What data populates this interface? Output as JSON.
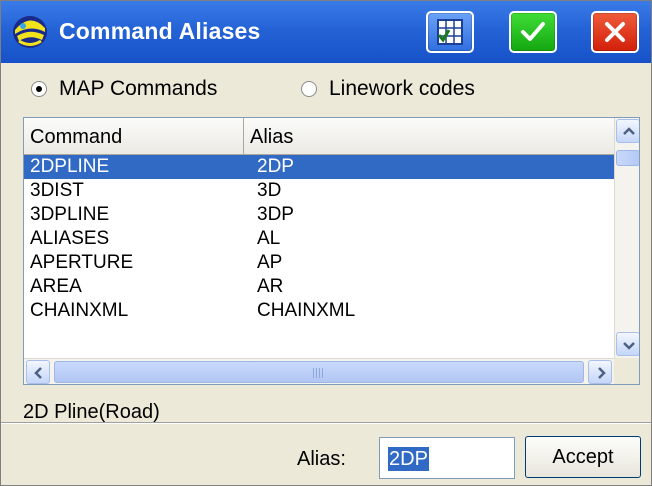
{
  "window": {
    "title": "Command Aliases",
    "icons": {
      "app": "helmet-icon",
      "grid": "grid-check-icon",
      "ok": "checkmark-icon",
      "close": "close-icon"
    },
    "colors": {
      "titlebar": "#2463d6",
      "ok": "#1fbf19",
      "close": "#e0341a",
      "selection": "#316ac5"
    }
  },
  "filter": {
    "options": [
      {
        "label": "MAP Commands",
        "checked": true
      },
      {
        "label": "Linework codes",
        "checked": false
      }
    ]
  },
  "list": {
    "columns": [
      "Command",
      "Alias"
    ],
    "rows": [
      {
        "command": "2DPLINE",
        "alias": "2DP",
        "selected": true
      },
      {
        "command": "3DIST",
        "alias": "3D",
        "selected": false
      },
      {
        "command": "3DPLINE",
        "alias": "3DP",
        "selected": false
      },
      {
        "command": "ALIASES",
        "alias": "AL",
        "selected": false
      },
      {
        "command": "APERTURE",
        "alias": "AP",
        "selected": false
      },
      {
        "command": "AREA",
        "alias": "AR",
        "selected": false
      },
      {
        "command": "CHAINXML",
        "alias": "CHAINXML",
        "selected": false
      }
    ]
  },
  "details": {
    "description": "2D Pline(Road)"
  },
  "edit": {
    "alias_label": "Alias:",
    "alias_value": "2DP",
    "accept_label": "Accept"
  }
}
